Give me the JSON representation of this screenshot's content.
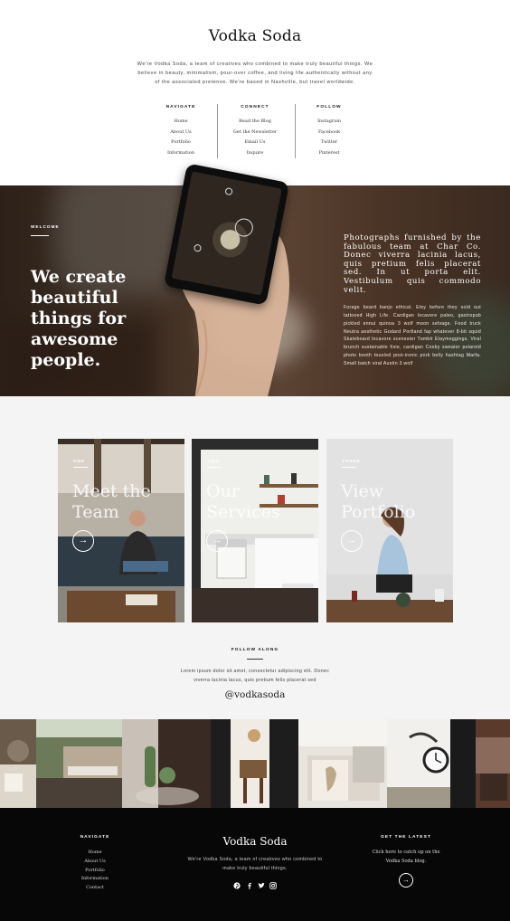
{
  "header": {
    "title": "Vodka Soda",
    "intro": "We're Vodka Soda, a team of creatives who combined to make truly beautiful things. We believe in beauty, minimalism, pour-over coffee, and living life authentically without any of the associated pretense. We're based in Nashville, but travel worldwide.",
    "columns": [
      {
        "heading": "NAVIGATE",
        "links": [
          "Home",
          "About Us",
          "Portfolio",
          "Information"
        ]
      },
      {
        "heading": "CONNECT",
        "links": [
          "Read the Blog",
          "Get the Newsletter",
          "Email Us",
          "Inquire"
        ]
      },
      {
        "heading": "FOLLOW",
        "links": [
          "Instagram",
          "Facebook",
          "Twitter",
          "Pinterest"
        ]
      }
    ]
  },
  "hero": {
    "label": "WELCOME",
    "headline": "We create beautiful things for awesome people.",
    "lead": "Photographs furnished by the fabulous team at Char Co. Donec viverra lacinia lacus, quis pretium felis placerat sed. In ut porta elit. Vestibulum quis commodo velit.",
    "body": "Forage beard banjo ethical. Etsy before they sold out tattooed High Life. Cardigan locavore paleo, gastropub pickled ennui quinoa 3 wolf moon selvage. Food truck Neutra aesthetic Godard Portland fap whatever 8-bit squid Skateboard locavore scenester Tumblr Etsymeggings. Viral brunch sustainable fixie, cardigan Cosby sweater polaroid photo booth tousled post-ironic pork belly hashtag Marfa. Small batch viral Austin 3 wolf"
  },
  "cards": [
    {
      "num": "ONE",
      "title": "Meet the Team",
      "arrow": "→"
    },
    {
      "num": "TWO",
      "title": "Our Services",
      "arrow": "→"
    },
    {
      "num": "THREE",
      "title": "View Portfolio",
      "arrow": "→"
    }
  ],
  "follow": {
    "label": "FOLLOW ALONG",
    "body": "Lorem ipsum dolor sit amet, consectetur adipiscing elit. Donec viverra lacinia lacus, quis pretium felis placerat sed",
    "handle": "@vodkasoda"
  },
  "footer": {
    "nav_heading": "NAVIGATE",
    "nav_links": [
      "Home",
      "About Us",
      "Portfolio",
      "Information",
      "Contact"
    ],
    "title": "Vodka Soda",
    "body": "We're Vodka Soda, a team of creatives who combined to make truly beautiful things.",
    "right_heading": "GET THE LATEST",
    "right_body": "Click here to catch up on the Vodka Soda blog.",
    "arrow": "→",
    "socials": [
      "pinterest-icon",
      "facebook-icon",
      "twitter-icon",
      "instagram-icon"
    ]
  }
}
